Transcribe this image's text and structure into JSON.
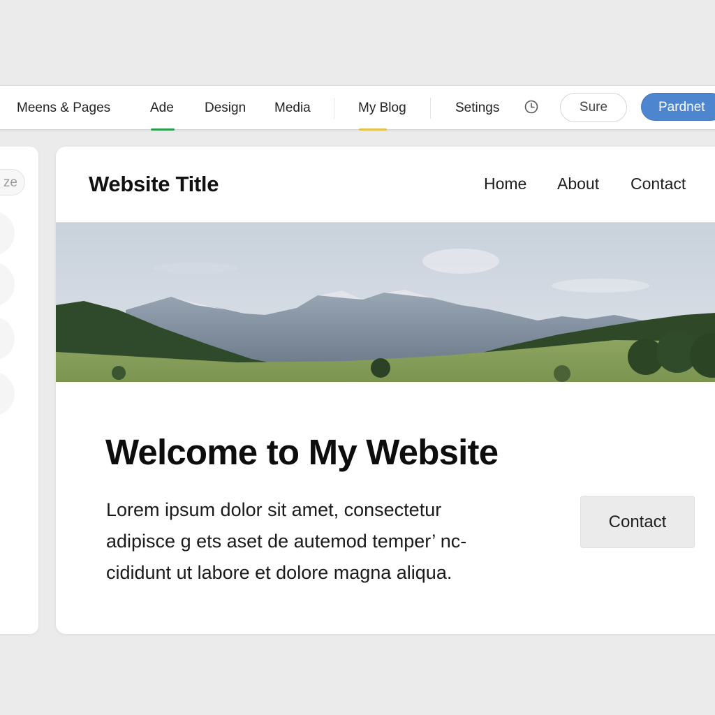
{
  "toolbar": {
    "items": [
      {
        "label": "Meens & Pages"
      },
      {
        "label": "Ade"
      },
      {
        "label": "Design"
      },
      {
        "label": "Media"
      },
      {
        "label": "My Blog"
      },
      {
        "label": "Setings"
      }
    ],
    "secondary_button": "Sure",
    "primary_button": "Pardnet",
    "accent_color": "#4d86cf"
  },
  "side_panel": {
    "pill_text": "ze"
  },
  "website": {
    "title": "Website Title",
    "nav": [
      "Home",
      "About",
      "Contact"
    ],
    "heading": "Welcome to My Website",
    "body_lines": [
      "Lorem ipsum dolor sit amet, consectetur",
      "adipisce g ets aset de autemod temper’ nc-",
      "cididunt ut labore et dolore magna aliqua."
    ],
    "cta_label": "Contact"
  }
}
